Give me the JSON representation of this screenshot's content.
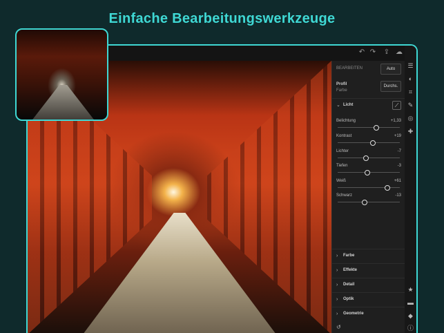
{
  "headline": "Einfache Bearbeitungswerkzeuge",
  "topbar": {
    "icons": [
      "undo-icon",
      "redo-icon",
      "share-icon",
      "cloud-icon",
      "more-icon"
    ],
    "more_glyph": "•••"
  },
  "panel": {
    "edit_label": "BEARBEITEN",
    "auto_button": "Auto",
    "profile_label": "Profil",
    "profile_value": "Farbe",
    "browse_button": "Durchs.",
    "light_section": "Licht",
    "sliders": [
      {
        "label": "Belichtung",
        "value": "+1,33",
        "fraction": 0.62
      },
      {
        "label": "Kontrast",
        "value": "+19",
        "fraction": 0.57
      },
      {
        "label": "Lichter",
        "value": "-7",
        "fraction": 0.46
      },
      {
        "label": "Tiefen",
        "value": "-3",
        "fraction": 0.48
      },
      {
        "label": "Weiß",
        "value": "+61",
        "fraction": 0.8
      },
      {
        "label": "Schwarz",
        "value": "-13",
        "fraction": 0.43
      }
    ],
    "sections": [
      "Farbe",
      "Effekte",
      "Detail",
      "Optik",
      "Geometrie"
    ]
  },
  "rail": {
    "top_icons": [
      "sliders-icon",
      "presets-icon",
      "crop-icon",
      "brush-icon",
      "radial-icon",
      "heal-icon"
    ],
    "bottom_icons": [
      "star-icon",
      "comment-icon",
      "tag-icon",
      "info-icon"
    ]
  },
  "colors": {
    "accent": "#3fd8d4",
    "background": "#0f2a2c",
    "panel": "#1f1f1f"
  }
}
